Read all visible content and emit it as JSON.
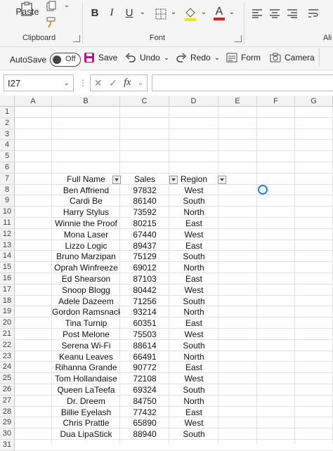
{
  "ribbon": {
    "paste_label": "Paste",
    "clipboard_label": "Clipboard",
    "font_label": "Font",
    "align_label": "Ali",
    "bold": "B",
    "italic": "I",
    "underline": "U",
    "font_color_glyph": "A"
  },
  "qat": {
    "autosave_label": "AutoSave",
    "autosave_state": "Off",
    "save_label": "Save",
    "undo_label": "Undo",
    "redo_label": "Redo",
    "form_label": "Form",
    "camera_label": "Camera"
  },
  "formula_bar": {
    "name_box": "I27",
    "fx_label": "fx",
    "formula_value": ""
  },
  "columns": [
    "A",
    "B",
    "C",
    "D",
    "E",
    "F",
    "G"
  ],
  "rows": [
    "1",
    "2",
    "3",
    "4",
    "5",
    "6",
    "7",
    "8",
    "9",
    "10",
    "11",
    "12",
    "13",
    "14",
    "15",
    "16",
    "17",
    "18",
    "19",
    "20",
    "21",
    "22",
    "23",
    "24",
    "25",
    "26",
    "27",
    "28",
    "29",
    "30",
    "31"
  ],
  "table": {
    "headers": [
      "Full Name",
      "Sales",
      "Region"
    ],
    "data": [
      [
        "Ben Affriend",
        "97832",
        "West"
      ],
      [
        "Cardi Be",
        "86140",
        "South"
      ],
      [
        "Harry Stylus",
        "73592",
        "North"
      ],
      [
        "Winnie the Proof",
        "80215",
        "East"
      ],
      [
        "Mona Laser",
        "67440",
        "West"
      ],
      [
        "Lizzo Logic",
        "89437",
        "East"
      ],
      [
        "Bruno Marzipan",
        "75129",
        "South"
      ],
      [
        "Oprah Winfreeze",
        "69012",
        "North"
      ],
      [
        "Ed Shearson",
        "87103",
        "East"
      ],
      [
        "Snoop Blogg",
        "80442",
        "West"
      ],
      [
        "Adele Dazeem",
        "71256",
        "South"
      ],
      [
        "Gordon Ramsnack",
        "93214",
        "North"
      ],
      [
        "Tina Turnip",
        "60351",
        "East"
      ],
      [
        "Post Melone",
        "75503",
        "West"
      ],
      [
        "Serena Wi-Fi",
        "88614",
        "South"
      ],
      [
        "Keanu Leaves",
        "66491",
        "North"
      ],
      [
        "Rihanna Grande",
        "90772",
        "East"
      ],
      [
        "Tom Hollandaise",
        "72108",
        "West"
      ],
      [
        "Queen LaTeefa",
        "69324",
        "South"
      ],
      [
        "Dr. Dreem",
        "84750",
        "North"
      ],
      [
        "Billie Eyelash",
        "77432",
        "East"
      ],
      [
        "Chris Prattle",
        "65890",
        "West"
      ],
      [
        "Dua LipaStick",
        "88940",
        "South"
      ]
    ]
  },
  "colors": {
    "save_icon": "#b1178f",
    "fill_color": "#f2e600",
    "font_color": "#e01c1c",
    "busy_indicator": "#1f7fe0"
  }
}
